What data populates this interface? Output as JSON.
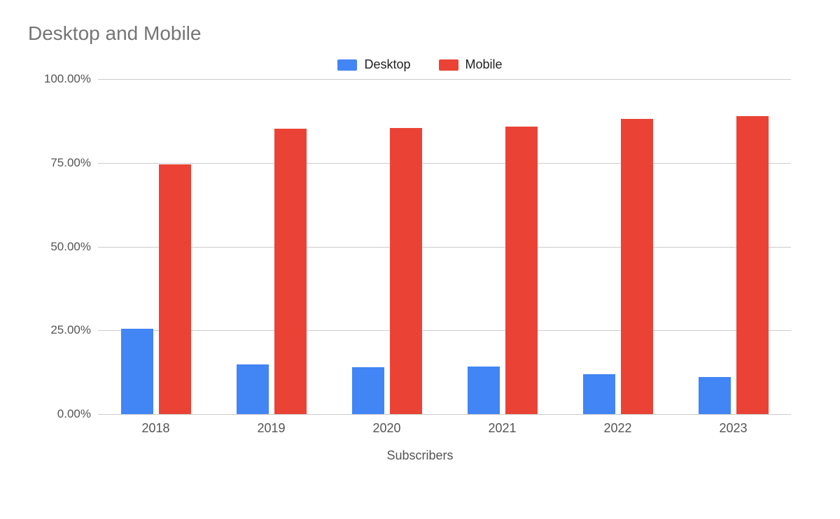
{
  "chart_data": {
    "type": "bar",
    "title": "Desktop and Mobile",
    "xlabel": "Subscribers",
    "ylabel": "",
    "ylim": [
      0,
      100
    ],
    "y_ticks": [
      0,
      25,
      50,
      75,
      100
    ],
    "y_tick_labels": [
      "0.00%",
      "25.00%",
      "50.00%",
      "75.00%",
      "100.00%"
    ],
    "categories": [
      "2018",
      "2019",
      "2020",
      "2021",
      "2022",
      "2023"
    ],
    "series": [
      {
        "name": "Desktop",
        "color": "#4285f4",
        "values": [
          25.5,
          14.8,
          14.0,
          14.2,
          12.0,
          11.0
        ]
      },
      {
        "name": "Mobile",
        "color": "#ea4335",
        "values": [
          74.5,
          85.2,
          85.3,
          85.8,
          88.0,
          89.0
        ]
      }
    ],
    "legend_position": "top",
    "grid": true
  }
}
